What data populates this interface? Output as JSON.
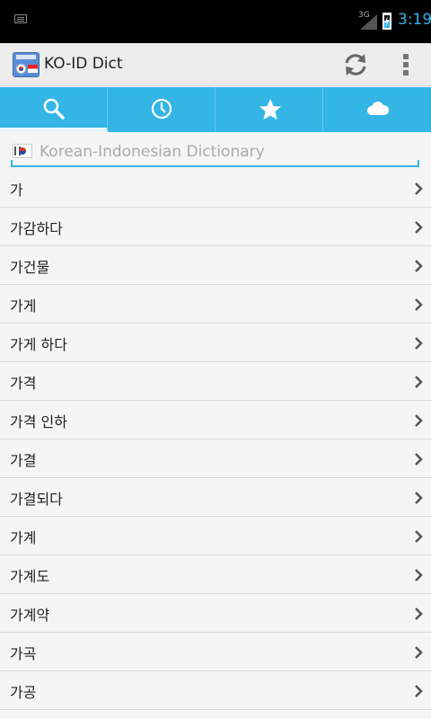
{
  "status_bar": {
    "network_label": "3G",
    "time": "3:19",
    "battery_level": 0.55
  },
  "action_bar": {
    "app_title": "KO-ID Dict",
    "refresh_icon": "refresh-icon",
    "overflow_icon": "overflow-menu-icon"
  },
  "tabs": [
    {
      "icon": "search-icon",
      "active": true
    },
    {
      "icon": "history-clock-icon",
      "active": false
    },
    {
      "icon": "favorites-star-icon",
      "active": false
    },
    {
      "icon": "cloud-icon",
      "active": false
    }
  ],
  "search": {
    "placeholder": "Korean-Indonesian Dictionary",
    "value": ""
  },
  "words": [
    "가",
    "가감하다",
    "가건물",
    "가게",
    "가게 하다",
    "가격",
    "가격 인하",
    "가결",
    "가결되다",
    "가계",
    "가계도",
    "가계약",
    "가곡",
    "가공"
  ],
  "colors": {
    "accent": "#33b5e5",
    "status_bar": "#000000",
    "action_bar": "#ececec",
    "background": "#f5f5f5"
  }
}
